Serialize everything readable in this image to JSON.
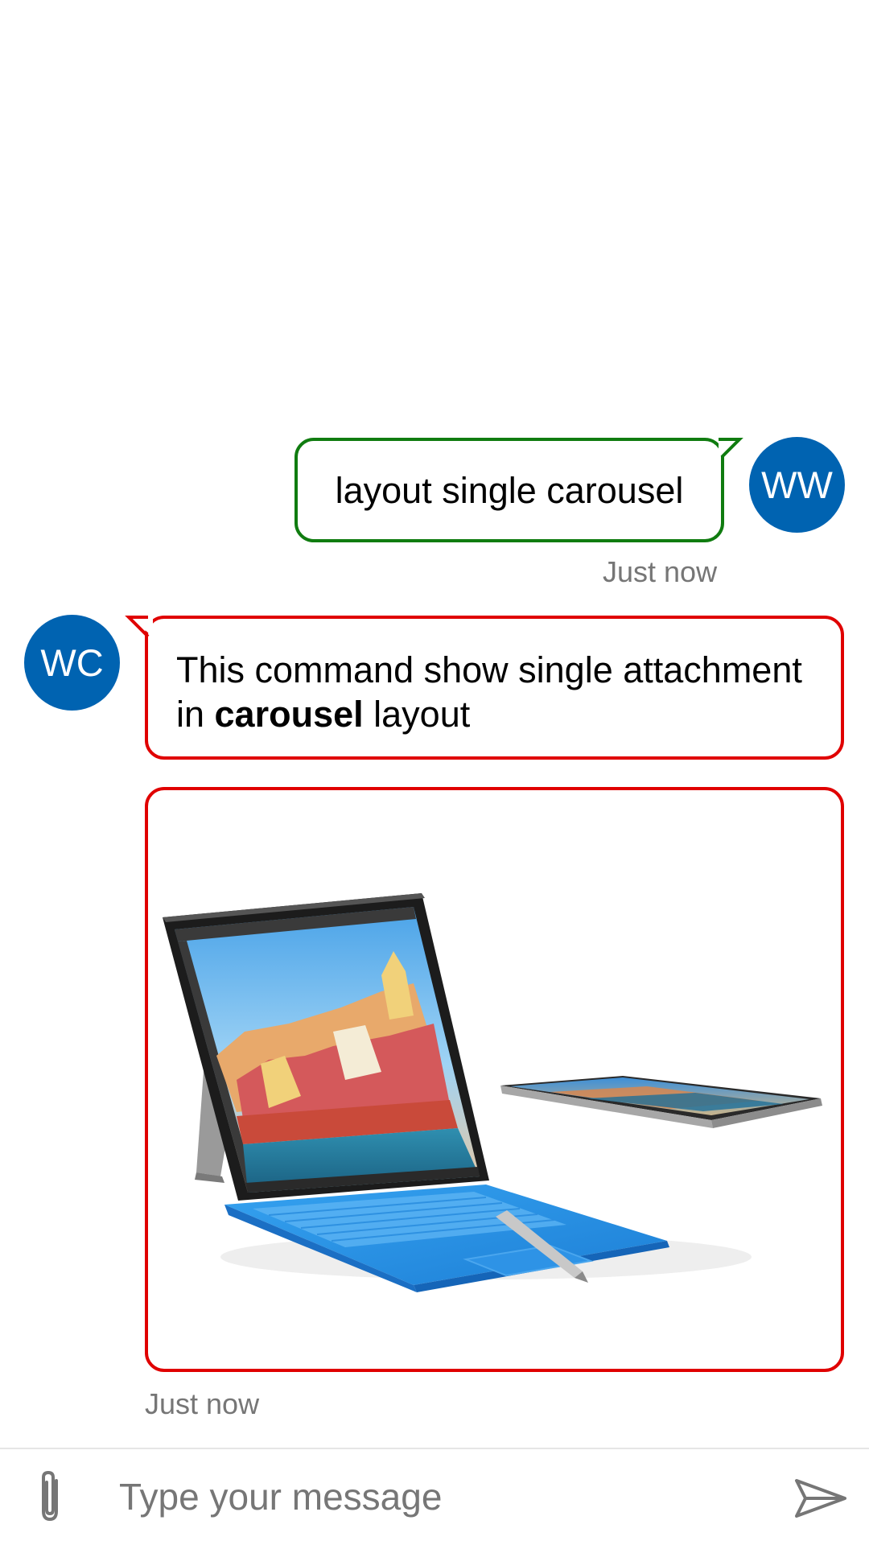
{
  "conversation": {
    "user_message": {
      "avatar_initials": "WW",
      "text": "layout single carousel",
      "timestamp": "Just now",
      "border_color": "#107c10"
    },
    "bot_message": {
      "avatar_initials": "WC",
      "text_before": "This command show single attachment in ",
      "text_bold": "carousel",
      "text_after": " layout",
      "timestamp": "Just now",
      "border_color": "#e00000"
    },
    "attachment": {
      "type": "image",
      "subject": "Surface Pro 4 tablet with blue keyboard cover, pen, and second tablet"
    }
  },
  "composer": {
    "placeholder": "Type your message",
    "attach_icon": "paperclip-icon",
    "send_icon": "send-icon"
  },
  "colors": {
    "avatar_bg": "#0063b1",
    "timestamp": "#767676",
    "highlight_user": "#107c10",
    "highlight_bot": "#e00000"
  }
}
